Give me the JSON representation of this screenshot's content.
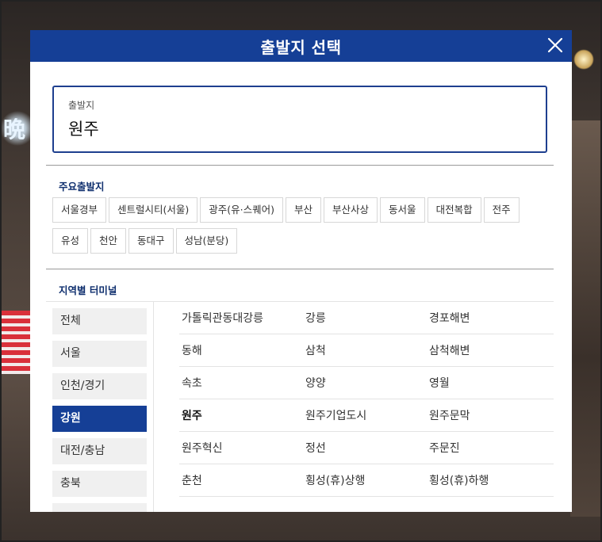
{
  "modal": {
    "title": "출발지 선택"
  },
  "origin": {
    "label": "출발지",
    "value": "원주"
  },
  "major": {
    "title": "주요출발지",
    "items": [
      "서울경부",
      "센트럴시티(서울)",
      "광주(유·스퀘어)",
      "부산",
      "부산사상",
      "동서울",
      "대전복합",
      "전주",
      "유성",
      "천안",
      "동대구",
      "성남(분당)"
    ]
  },
  "regional": {
    "title": "지역별 터미널",
    "regions": [
      "전체",
      "서울",
      "인천/경기",
      "강원",
      "대전/충남",
      "충북"
    ],
    "active_region": "강원",
    "terminals": [
      [
        "가톨릭관동대강릉",
        "강릉",
        "경포해변"
      ],
      [
        "동해",
        "삼척",
        "삼척해변"
      ],
      [
        "속초",
        "양양",
        "영월"
      ],
      [
        "원주",
        "원주기업도시",
        "원주문막"
      ],
      [
        "원주혁신",
        "정선",
        "주문진"
      ],
      [
        "춘천",
        "횡성(휴)상행",
        "횡성(휴)하행"
      ]
    ],
    "selected_terminal": "원주"
  },
  "colors": {
    "header": "#153f96",
    "accent": "#153f96",
    "section_title": "#0f2f6e"
  },
  "icons": {
    "close": "close-icon"
  }
}
